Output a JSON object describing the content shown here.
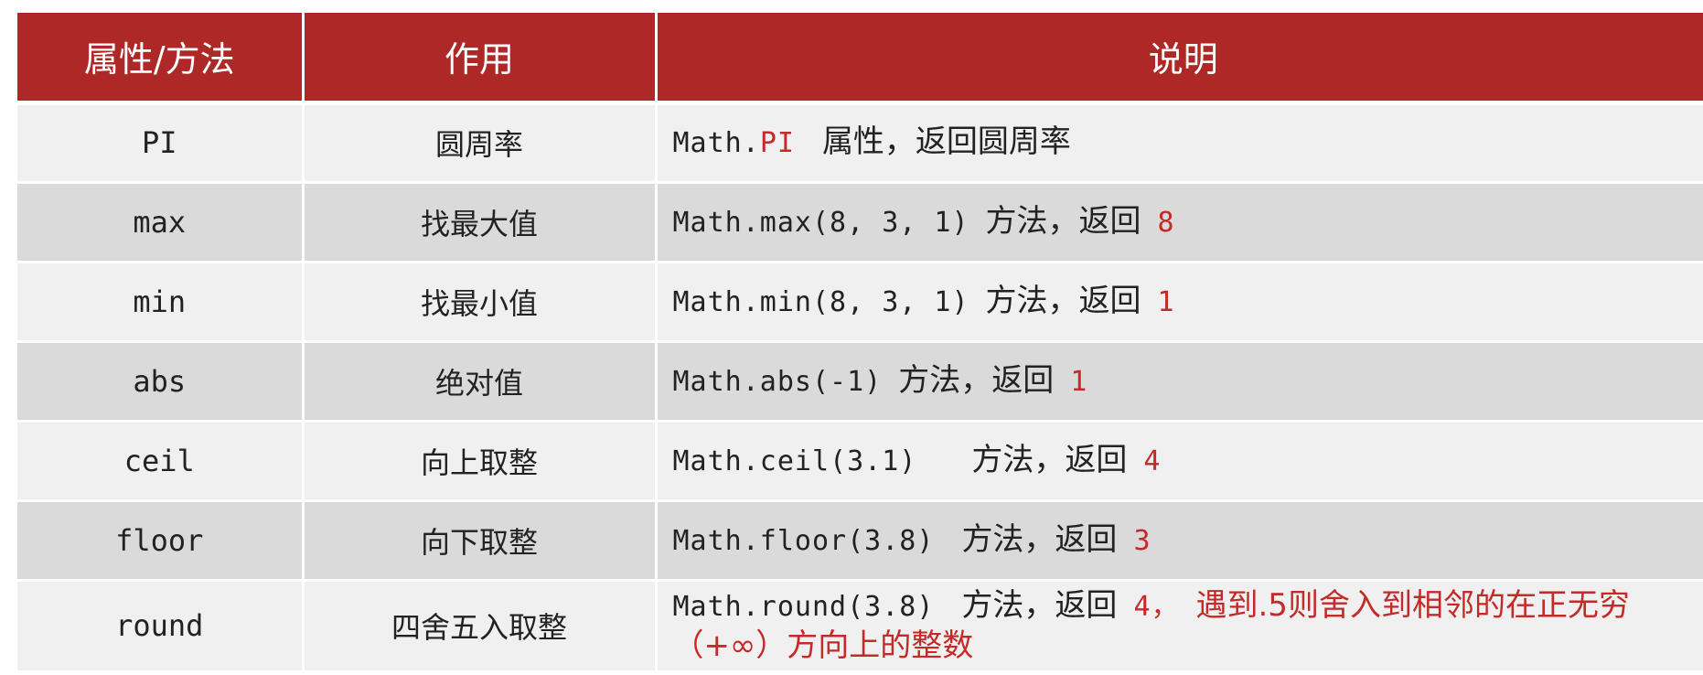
{
  "header": {
    "col1": "属性/方法",
    "col2": "作用",
    "col3": "说明"
  },
  "rows": [
    {
      "name": "PI",
      "func": "圆周率",
      "desc_code": "Math.",
      "desc_code_red": "PI",
      "desc_text": "属性，返回圆周率"
    },
    {
      "name": "max",
      "func": "找最大值",
      "desc_code": "Math.max(8, 3, 1)",
      "desc_text": "方法，返回",
      "desc_result": "8"
    },
    {
      "name": "min",
      "func": "找最小值",
      "desc_code": "Math.min(8, 3, 1)",
      "desc_text": "方法，返回",
      "desc_result": "1"
    },
    {
      "name": "abs",
      "func": "绝对值",
      "desc_code": "Math.abs(-1)",
      "desc_text": "方法，返回",
      "desc_result": "1"
    },
    {
      "name": "ceil",
      "func": "向上取整",
      "desc_code": "Math.ceil(3.1)",
      "desc_text": "方法，返回",
      "desc_result": "4"
    },
    {
      "name": "floor",
      "func": "向下取整",
      "desc_code": "Math.floor(3.8)",
      "desc_text": "方法，返回",
      "desc_result": "3"
    },
    {
      "name": "round",
      "func": "四舍五入取整",
      "desc_code": "Math.round(3.8)",
      "desc_text": "方法，返回",
      "desc_result": "4，",
      "desc_note": "遇到.5则舍入到相邻的在正无穷（+∞）方向上的整数"
    }
  ],
  "colors": {
    "header_bg": "#ad2826",
    "header_text": "#ffffff",
    "row_light": "#f0f0f0",
    "row_dark": "#dadada",
    "highlight": "#c32a28"
  }
}
